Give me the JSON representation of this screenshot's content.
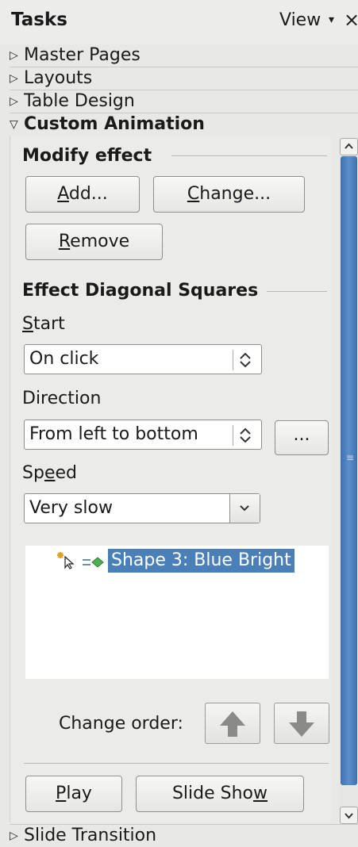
{
  "header": {
    "title": "Tasks",
    "view_label": "View",
    "view_arrow": "▾",
    "close": "×"
  },
  "decks": [
    {
      "label": "Master Pages",
      "expanded": false
    },
    {
      "label": "Layouts",
      "expanded": false
    },
    {
      "label": "Table Design",
      "expanded": false
    },
    {
      "label": "Custom Animation",
      "expanded": true
    },
    {
      "label": "Slide Transition",
      "expanded": false
    }
  ],
  "modify_effect": {
    "heading": "Modify effect",
    "add_label": {
      "mn": "A",
      "rest": "dd..."
    },
    "change_label": {
      "mn": "C",
      "rest": "hange..."
    },
    "remove_label": {
      "mn": "R",
      "rest": "emove"
    }
  },
  "effect": {
    "heading": "Effect Diagonal Squares",
    "start_label": {
      "mn": "S",
      "rest": "tart"
    },
    "start_value": "On click",
    "direction_label": "Direction",
    "direction_value": "From left to bottom",
    "options_button": "...",
    "speed_label": {
      "pre": "Sp",
      "mn": "e",
      "rest": "ed"
    },
    "speed_value": "Very slow"
  },
  "animation_list": [
    {
      "label": "Shape 3: Blue Bright",
      "selected": true
    }
  ],
  "order": {
    "label": "Change order:"
  },
  "footer": {
    "play_label": {
      "mn": "P",
      "rest": "lay"
    },
    "slideshow_label": {
      "pre": "Slide Sho",
      "mn": "w"
    }
  },
  "colors": {
    "accent": "#4a7fb8",
    "scroll_thumb": "#4a80bd",
    "panel_bg": "#ebebe9"
  }
}
